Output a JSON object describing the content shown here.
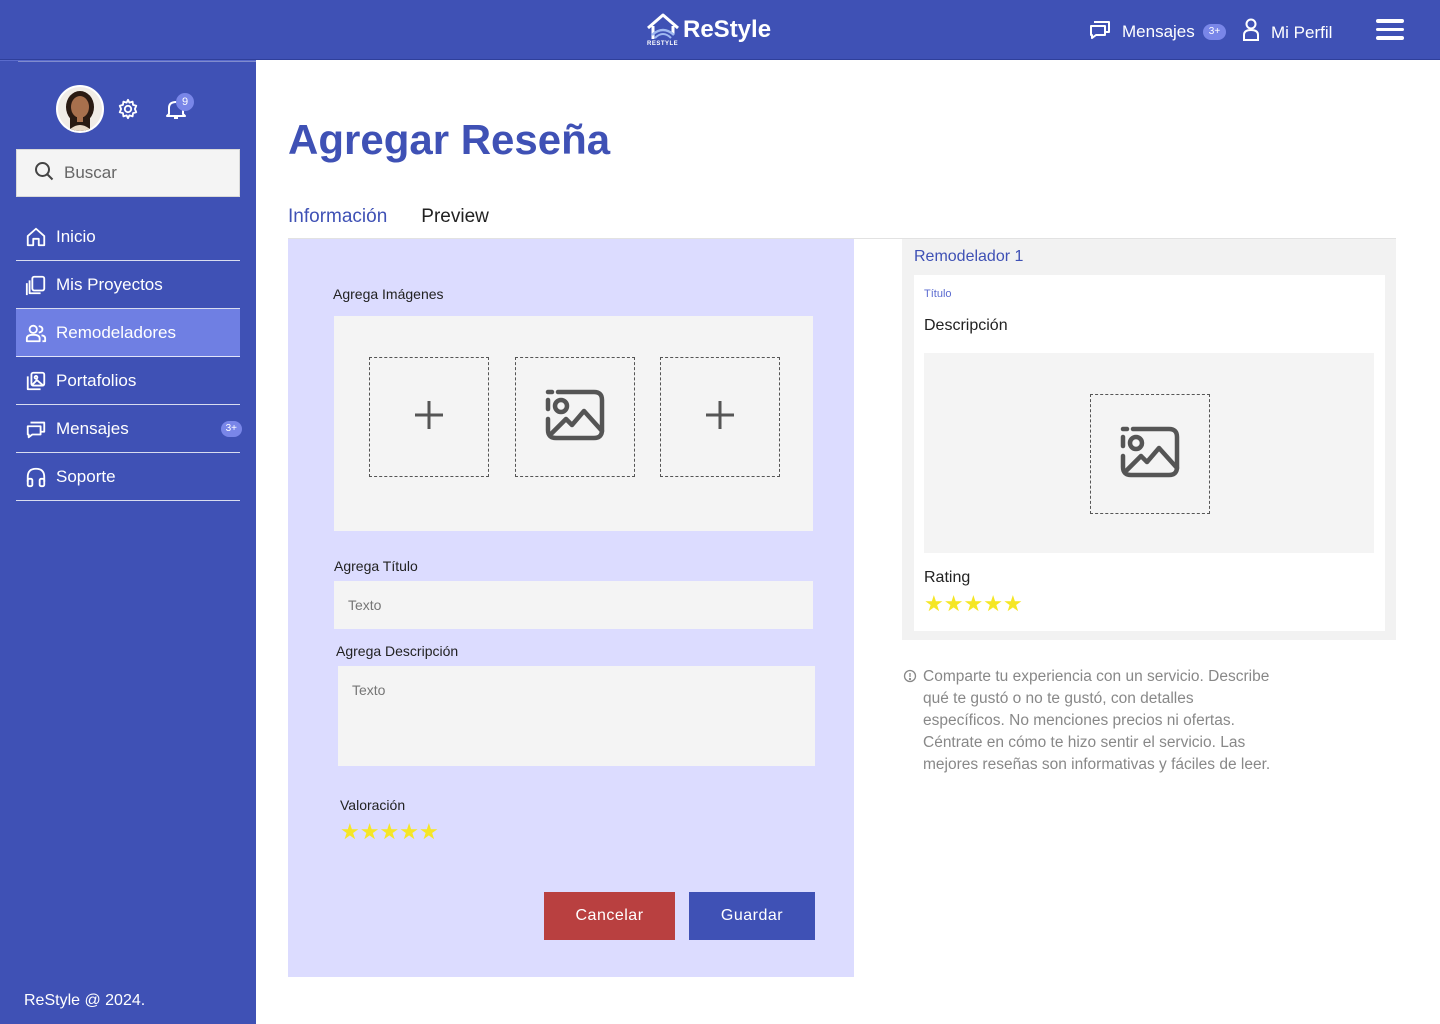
{
  "header": {
    "logo_text": "ReStyle",
    "logo_small": "RESTYLE",
    "messages_label": "Mensajes",
    "messages_badge": "3+",
    "profile_label": "Mi Perfil"
  },
  "sidebar": {
    "notifications_count": "9",
    "search_placeholder": "Buscar",
    "items": [
      {
        "label": "Inicio",
        "icon": "home-icon"
      },
      {
        "label": "Mis Proyectos",
        "icon": "projects-icon"
      },
      {
        "label": "Remodeladores",
        "icon": "users-icon",
        "active": true
      },
      {
        "label": "Portafolios",
        "icon": "portfolio-icon"
      },
      {
        "label": "Mensajes",
        "icon": "chat-icon",
        "badge": "3+"
      },
      {
        "label": "Soporte",
        "icon": "headset-icon"
      }
    ],
    "footer": "ReStyle @ 2024."
  },
  "main": {
    "title": "Agregar Reseña",
    "tabs": [
      {
        "label": "Información",
        "active": true
      },
      {
        "label": "Preview"
      }
    ],
    "form": {
      "images_label": "Agrega Imágenes",
      "title_label": "Agrega Título",
      "title_placeholder": "Texto",
      "description_label": "Agrega Descripción",
      "description_placeholder": "Texto",
      "rating_label": "Valoración",
      "rating_value": 5,
      "cancel_label": "Cancelar",
      "save_label": "Guardar"
    },
    "preview": {
      "remodeler_name": "Remodelador 1",
      "title": "Título",
      "description": "Descripción",
      "rating_label": "Rating",
      "rating_value": 5
    },
    "hint": "Comparte tu experiencia con un servicio. Describe qué te gustó o no te gustó, con detalles específicos. No menciones precios ni ofertas. Céntrate en cómo te hizo sentir el servicio. Las mejores reseñas son informativas y fáciles de leer."
  },
  "colors": {
    "primary": "#3f51b5",
    "active_nav": "#6f7fe3",
    "form_bg": "#dcdcff",
    "cancel": "#b94040",
    "star": "#f5e625"
  }
}
